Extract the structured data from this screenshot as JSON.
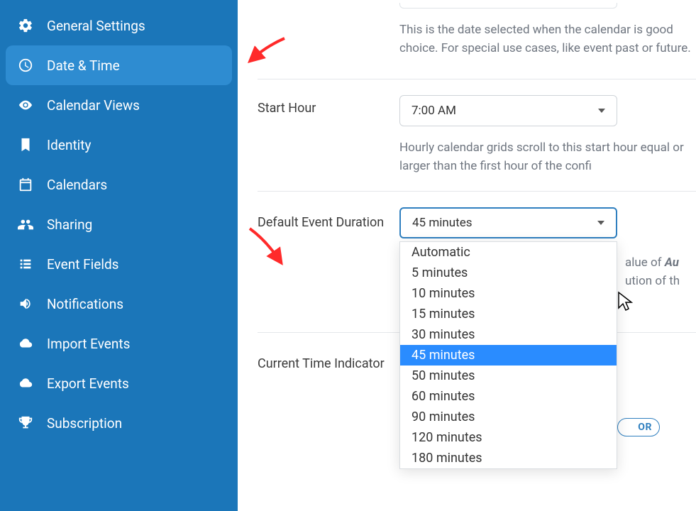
{
  "sidebar": {
    "items": [
      {
        "label": "General Settings",
        "icon": "gear-icon",
        "active": false
      },
      {
        "label": "Date & Time",
        "icon": "clock-icon",
        "active": true
      },
      {
        "label": "Calendar Views",
        "icon": "eye-icon",
        "active": false
      },
      {
        "label": "Identity",
        "icon": "bookmark-icon",
        "active": false
      },
      {
        "label": "Calendars",
        "icon": "calendar-icon",
        "active": false
      },
      {
        "label": "Sharing",
        "icon": "users-icon",
        "active": false
      },
      {
        "label": "Event Fields",
        "icon": "list-icon",
        "active": false
      },
      {
        "label": "Notifications",
        "icon": "volume-icon",
        "active": false
      },
      {
        "label": "Import Events",
        "icon": "cloud-up-icon",
        "active": false
      },
      {
        "label": "Export Events",
        "icon": "cloud-down-icon",
        "active": false
      },
      {
        "label": "Subscription",
        "icon": "trophy-icon",
        "active": false
      }
    ]
  },
  "main": {
    "default_date_help": "This is the date selected when the calendar is good choice. For special use cases, like event past or future.",
    "start_hour": {
      "label": "Start Hour",
      "value": "7:00 AM",
      "help": "Hourly calendar grids scroll to this start hour equal or larger than the first hour of the confi"
    },
    "default_duration": {
      "label": "Default Event Duration",
      "value": "45 minutes",
      "options": [
        "Automatic",
        "5 minutes",
        "10 minutes",
        "15 minutes",
        "30 minutes",
        "45 minutes",
        "50 minutes",
        "60 minutes",
        "90 minutes",
        "120 minutes",
        "180 minutes"
      ],
      "help_prefix": "alue of ",
      "help_bold": "Au",
      "help_suffix": "ution of th"
    },
    "current_time_indicator": {
      "label": "Current Time Indicator",
      "pill": "OR"
    }
  }
}
